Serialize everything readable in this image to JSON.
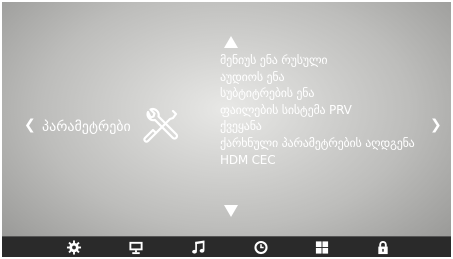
{
  "nav": {
    "left_arrow": "❮",
    "right_arrow": "❯"
  },
  "category": {
    "title": "პარამეტრები",
    "icon": "tools-icon"
  },
  "menu": {
    "scroll_up_icon": "triangle-up-icon",
    "scroll_down_icon": "triangle-down-icon",
    "items": [
      "მენიუს ენა  რუსული",
      "აუდიოს ენა",
      "სუბტიტრების ენა",
      "ფაილების სისტემა PRV",
      "ქვეყანა",
      "ქარხნული პარამეტრების აღდგენა",
      "HDM CEC"
    ]
  },
  "bottom_tabs": [
    {
      "name": "settings",
      "icon": "gear-icon"
    },
    {
      "name": "display",
      "icon": "monitor-icon"
    },
    {
      "name": "audio",
      "icon": "music-note-icon"
    },
    {
      "name": "time",
      "icon": "clock-icon",
      "active": true
    },
    {
      "name": "apps",
      "icon": "grid-icon"
    },
    {
      "name": "lock",
      "icon": "lock-icon"
    }
  ],
  "colors": {
    "text": "#ffffff",
    "bar": "#2a2a2a",
    "background_center": "#e8e8e6",
    "background_edge": "#8e8e8c"
  }
}
